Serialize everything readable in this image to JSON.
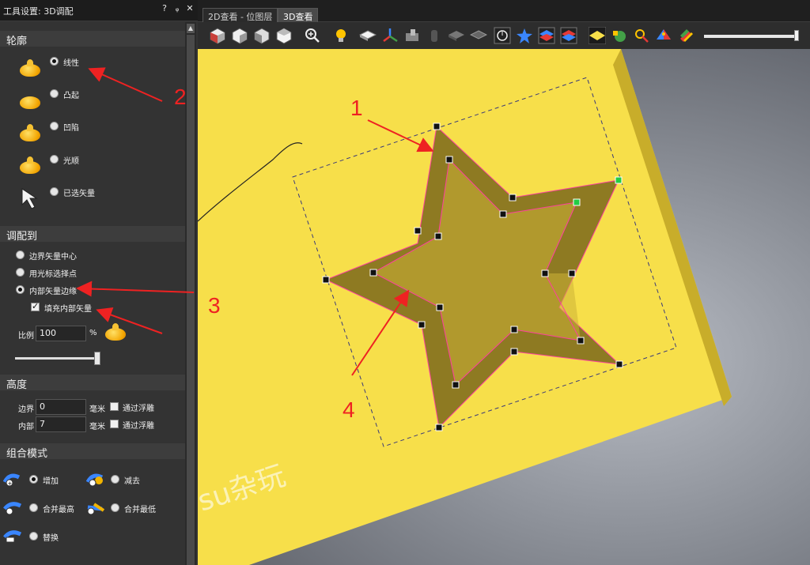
{
  "panel": {
    "title": "工具设置: 3D调配",
    "controls": {
      "help": "?",
      "pin": "ᵩ",
      "close": "✕"
    },
    "profile": {
      "header": "轮廓",
      "options": [
        {
          "label": "线性",
          "selected": true,
          "icon": "dome-peak-icon"
        },
        {
          "label": "凸起",
          "selected": false,
          "icon": "dome-round-icon"
        },
        {
          "label": "凹陷",
          "selected": false,
          "icon": "dome-concave-icon"
        },
        {
          "label": "光顺",
          "selected": false,
          "icon": "dome-smooth-icon"
        },
        {
          "label": "已选矢量",
          "selected": false,
          "icon": "arrow-cursor-icon"
        }
      ]
    },
    "fit": {
      "header": "调配到",
      "options": [
        {
          "label": "边界矢量中心",
          "selected": false
        },
        {
          "label": "用光标选择点",
          "selected": false
        },
        {
          "label": "内部矢量边缘",
          "selected": true
        }
      ],
      "fill_checkbox": {
        "label": "填充内部矢量",
        "checked": true
      },
      "ratio": {
        "label": "比例",
        "value": "100",
        "unit": "%"
      },
      "slider_level": 1.0
    },
    "height": {
      "header": "高度",
      "rows": [
        {
          "label": "边界",
          "value": "0",
          "unit": "毫米",
          "check_label": "通过浮雕",
          "checked": false
        },
        {
          "label": "内部",
          "value": "7",
          "unit": "毫米",
          "check_label": "通过浮雕",
          "checked": false
        }
      ]
    },
    "combine": {
      "header": "组合模式",
      "options": [
        {
          "label": "增加",
          "selected": true
        },
        {
          "label": "减去",
          "selected": false
        },
        {
          "label": "合并最高",
          "selected": false
        },
        {
          "label": "合并最低",
          "selected": false
        },
        {
          "label": "替换",
          "selected": false
        }
      ]
    }
  },
  "tabs": [
    {
      "label": "2D查看 - 位图层",
      "active": false
    },
    {
      "label": "3D查看",
      "active": true
    }
  ],
  "toolbar": {
    "icons": [
      "view-iso-icon",
      "view-front-icon",
      "view-side-icon",
      "view-top-icon",
      "zoom-icon",
      "light-bulb-icon",
      "relief-layer-icon",
      "axes-icon",
      "machine-icon",
      "cylinder-icon",
      "shaded-icon",
      "wireframe-icon",
      "clock-icon",
      "star-vector-icon",
      "layer-blue-icon",
      "layer-red-icon",
      "material-yellow-icon",
      "green-blob-icon",
      "search-relief-icon",
      "palette-icon",
      "color-stack-icon"
    ],
    "zoom_slider_level": 1.0
  },
  "annotations": [
    {
      "text": "1",
      "color": "#ee2222"
    },
    {
      "text": "2",
      "color": "#ee2222"
    },
    {
      "text": "3",
      "color": "#ee2222"
    },
    {
      "text": "4",
      "color": "#ee2222"
    }
  ],
  "watermark": "su杂玩",
  "colors": {
    "relief": "#f7df4a",
    "star_shadow": "#7a6a18",
    "vector_line": "#ff3fa0",
    "annotation_red": "#ee2222"
  }
}
